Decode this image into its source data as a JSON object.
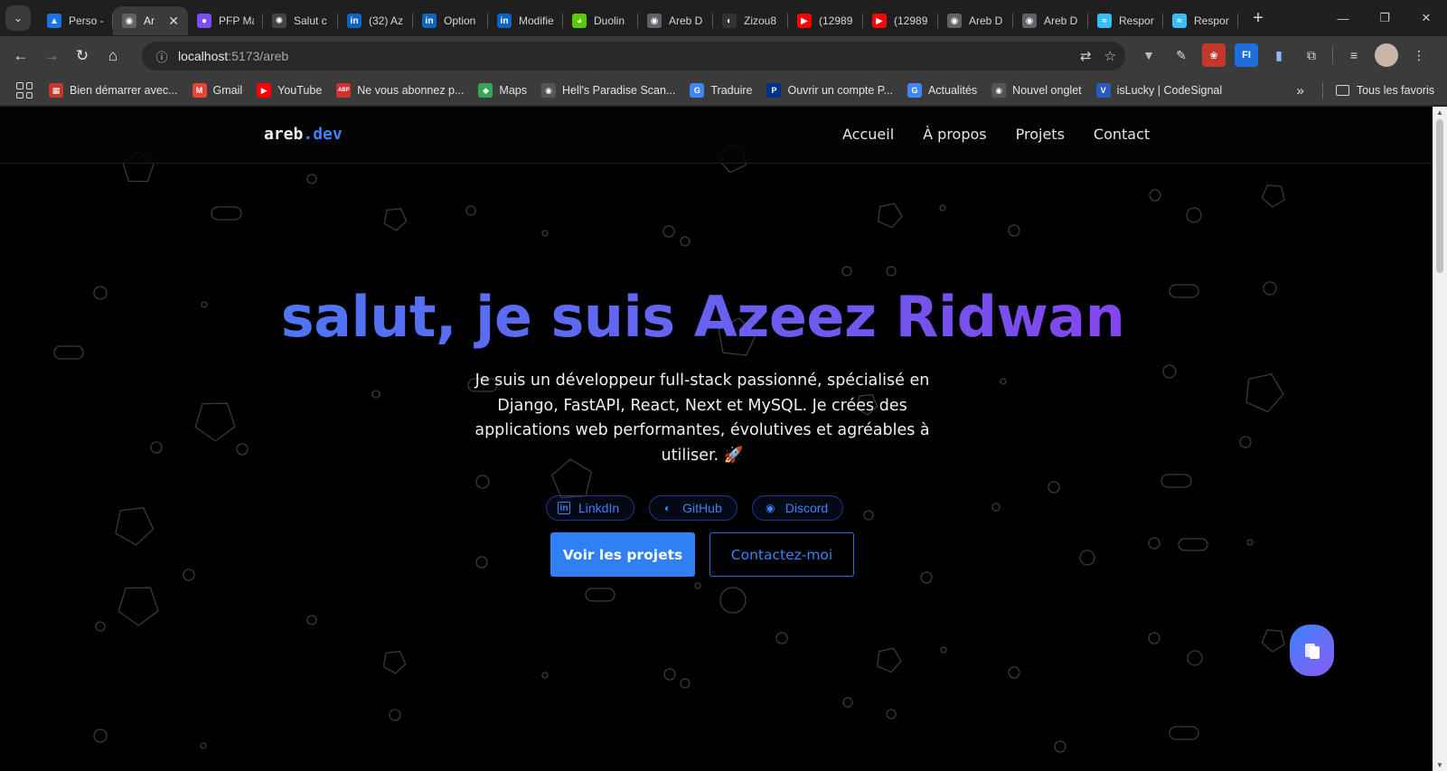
{
  "browser": {
    "tabs": [
      {
        "title": "Perso -",
        "color": "#1a73e8",
        "glyph": "▲"
      },
      {
        "title": "Ar",
        "color": "#5f6368",
        "glyph": "◉",
        "active": true
      },
      {
        "title": "PFP Ma",
        "color": "#7c4dff",
        "glyph": "●"
      },
      {
        "title": "Salut c",
        "color": "#444",
        "glyph": "✺"
      },
      {
        "title": "(32) Az",
        "color": "#0a66c2",
        "glyph": "in"
      },
      {
        "title": "Option",
        "color": "#0a66c2",
        "glyph": "in"
      },
      {
        "title": "Modifie",
        "color": "#0a66c2",
        "glyph": "in"
      },
      {
        "title": "Duolin",
        "color": "#58cc02",
        "glyph": "◕"
      },
      {
        "title": "Areb D",
        "color": "#5f6368",
        "glyph": "◉"
      },
      {
        "title": "Zizou8",
        "color": "#333",
        "glyph": "◐"
      },
      {
        "title": "(12989",
        "color": "#ff0000",
        "glyph": "▶"
      },
      {
        "title": "(12989",
        "color": "#ff0000",
        "glyph": "▶"
      },
      {
        "title": "Areb D",
        "color": "#5f6368",
        "glyph": "◉"
      },
      {
        "title": "Areb D",
        "color": "#5f6368",
        "glyph": "◉"
      },
      {
        "title": "Respon",
        "color": "#38bdf8",
        "glyph": "≈"
      },
      {
        "title": "Respon",
        "color": "#38bdf8",
        "glyph": "≈"
      }
    ],
    "close_glyph": "✕",
    "newtab_glyph": "+",
    "url_host": "localhost",
    "url_path": ":5173/areb",
    "bookmarks": [
      {
        "label": "Bien démarrer avec...",
        "color": "#c0392b",
        "glyph": "▦"
      },
      {
        "label": "Gmail",
        "color": "#ea4335",
        "glyph": "M"
      },
      {
        "label": "YouTube",
        "color": "#ff0000",
        "glyph": "▶"
      },
      {
        "label": "Ne vous abonnez p...",
        "color": "#d32f2f",
        "glyph": "ABP"
      },
      {
        "label": "Maps",
        "color": "#34a853",
        "glyph": "◆"
      },
      {
        "label": "Hell's Paradise Scan...",
        "color": "#555",
        "glyph": "◉"
      },
      {
        "label": "Traduire",
        "color": "#4285f4",
        "glyph": "G"
      },
      {
        "label": "Ouvrir un compte P...",
        "color": "#003087",
        "glyph": "P"
      },
      {
        "label": "Actualités",
        "color": "#4285f4",
        "glyph": "G"
      },
      {
        "label": "Nouvel onglet",
        "color": "#555",
        "glyph": "◉"
      },
      {
        "label": "isLucky | CodeSignal",
        "color": "#2b59c3",
        "glyph": "V"
      }
    ],
    "all_bookmarks": "Tous les favoris"
  },
  "site": {
    "logo_main": "areb",
    "logo_accent": ".dev",
    "nav": [
      "Accueil",
      "À propos",
      "Projets",
      "Contact"
    ],
    "hero_title": "salut, je suis Azeez Ridwan",
    "hero_subtitle": "Je suis un développeur full-stack passionné, spécialisé en Django, FastAPI, React, Next et MySQL. Je crées des applications web performantes, évolutives et agréables à utiliser. 🚀",
    "socials": [
      {
        "label": "LinkdIn",
        "icon": "linkedin-icon",
        "glyph": "in"
      },
      {
        "label": "GitHub",
        "icon": "github-icon",
        "glyph": "◐"
      },
      {
        "label": "Discord",
        "icon": "discord-icon",
        "glyph": "◉"
      }
    ],
    "cta_primary": "Voir les projets",
    "cta_secondary": "Contactez-moi"
  },
  "colors": {
    "accent": "#3b82f6",
    "gradient_start": "#3b82f6",
    "gradient_end": "#9333ea",
    "page_bg": "#000000"
  }
}
